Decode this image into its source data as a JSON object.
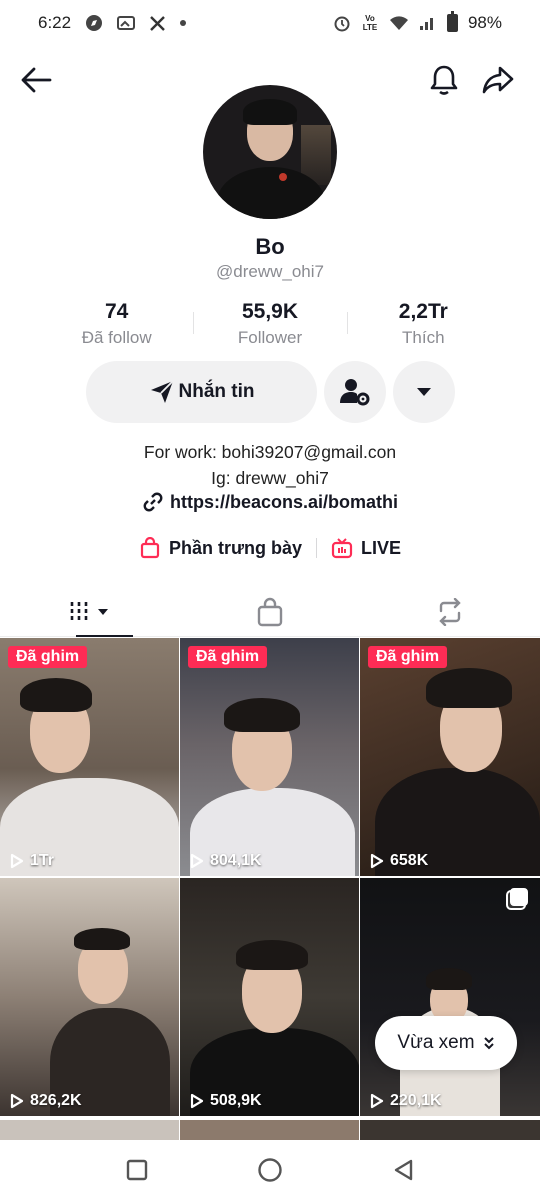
{
  "status_bar": {
    "time": "6:22",
    "battery": "98%",
    "network": "Vo LTE"
  },
  "header": {
    "back_icon": "back-arrow-icon",
    "bell_icon": "bell-icon",
    "share_icon": "share-icon"
  },
  "profile": {
    "name": "Bo",
    "handle": "@dreww_ohi7",
    "stats": [
      {
        "value": "74",
        "label": "Đã follow"
      },
      {
        "value": "55,9K",
        "label": "Follower"
      },
      {
        "value": "2,2Tr",
        "label": "Thích"
      }
    ],
    "message_label": "Nhắn tin",
    "bio_lines": [
      "For work: bohi39207@gmail.con",
      "Ig: dreww_ohi7"
    ],
    "link": "https://beacons.ai/bomathi",
    "showcase_label": "Phần trưng bày",
    "live_label": "LIVE"
  },
  "colors": {
    "accent": "#fe2c55",
    "text": "#161823",
    "muted": "#8a8b91",
    "button_bg": "#f1f1f2"
  },
  "videos": [
    {
      "pinned": "Đã ghim",
      "views": "1Tr"
    },
    {
      "pinned": "Đã ghim",
      "views": "804,1K"
    },
    {
      "pinned": "Đã ghim",
      "views": "658K"
    },
    {
      "pinned": "",
      "views": "826,2K"
    },
    {
      "pinned": "",
      "views": "508,9K"
    },
    {
      "pinned": "",
      "views": "220,1K"
    }
  ],
  "recent_pill": "Vừa xem"
}
